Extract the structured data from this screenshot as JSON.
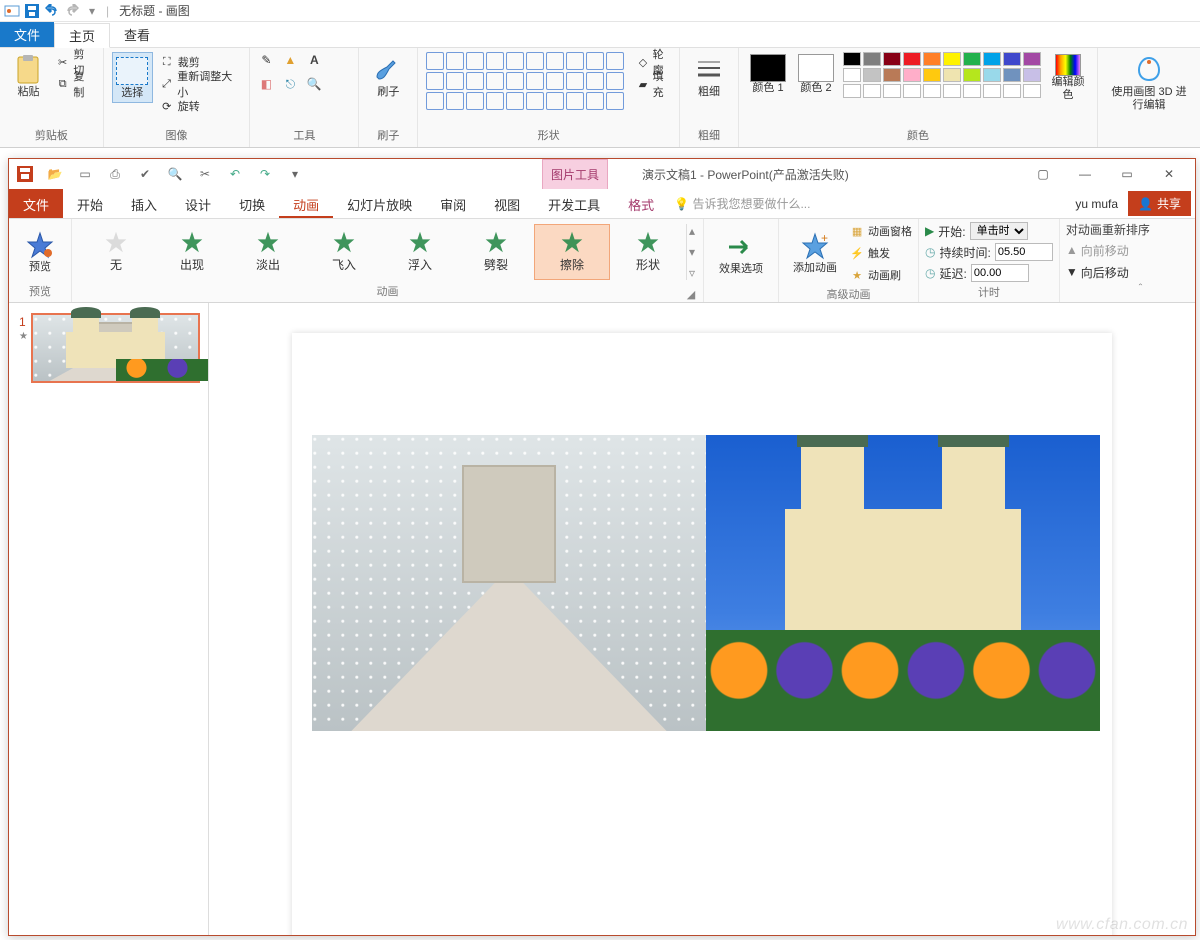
{
  "paint": {
    "title": "无标题 - 画图",
    "tabs": {
      "file": "文件",
      "home": "主页",
      "view": "查看"
    },
    "clipboard": {
      "group": "剪贴板",
      "paste": "粘贴",
      "cut": "剪切",
      "copy": "复制"
    },
    "image": {
      "group": "图像",
      "select": "选择",
      "crop": "裁剪",
      "resize": "重新调整大小",
      "rotate": "旋转"
    },
    "tools": {
      "group": "工具"
    },
    "brush": {
      "group": "刷子",
      "label": "刷子"
    },
    "shapes": {
      "group": "形状",
      "outline": "轮廓",
      "fill": "填充"
    },
    "size": {
      "group": "粗细",
      "label": "粗细"
    },
    "colors": {
      "group": "颜色",
      "c1": "颜色 1",
      "c2": "颜色 2",
      "edit": "编辑颜色",
      "row1": [
        "#000000",
        "#7f7f7f",
        "#880015",
        "#ed1c24",
        "#ff7f27",
        "#fff200",
        "#22b14c",
        "#00a2e8",
        "#3f48cc",
        "#a349a4"
      ],
      "row2": [
        "#ffffff",
        "#c3c3c3",
        "#b97a57",
        "#ffaec9",
        "#ffc90e",
        "#efe4b0",
        "#b5e61d",
        "#99d9ea",
        "#7092be",
        "#c8bfe7"
      ],
      "row3": [
        "#ffffff",
        "#ffffff",
        "#ffffff",
        "#ffffff",
        "#ffffff",
        "#ffffff",
        "#ffffff",
        "#ffffff",
        "#ffffff",
        "#ffffff"
      ]
    },
    "p3d": {
      "label": "使用画图 3D 进行编辑"
    }
  },
  "pp": {
    "context_tab_group": "图片工具",
    "title": "演示文稿1 - PowerPoint(产品激活失败)",
    "user": "yu mufa",
    "share": "共享",
    "tell_me": "告诉我您想要做什么...",
    "tabs": {
      "file": "文件",
      "home": "开始",
      "insert": "插入",
      "design": "设计",
      "transitions": "切换",
      "animations": "动画",
      "slideshow": "幻灯片放映",
      "review": "审阅",
      "view": "视图",
      "dev": "开发工具",
      "format": "格式"
    },
    "preview": {
      "label": "预览",
      "group": "预览"
    },
    "anim": {
      "group": "动画",
      "items": [
        "无",
        "出现",
        "淡出",
        "飞入",
        "浮入",
        "劈裂",
        "擦除",
        "形状"
      ],
      "selected_index": 6,
      "effect_options": "效果选项"
    },
    "advanced": {
      "group": "高级动画",
      "add": "添加动画",
      "pane": "动画窗格",
      "trigger": "触发",
      "painter": "动画刷"
    },
    "timing": {
      "group": "计时",
      "start_lbl": "开始:",
      "start_val": "单击时",
      "duration_lbl": "持续时间:",
      "duration_val": "05.50",
      "delay_lbl": "延迟:",
      "delay_val": "00.00"
    },
    "reorder": {
      "group": "对动画重新排序",
      "earlier": "向前移动",
      "later": "向后移动"
    },
    "thumb": {
      "number": "1"
    }
  },
  "watermark": "www.cfan.com.cn"
}
